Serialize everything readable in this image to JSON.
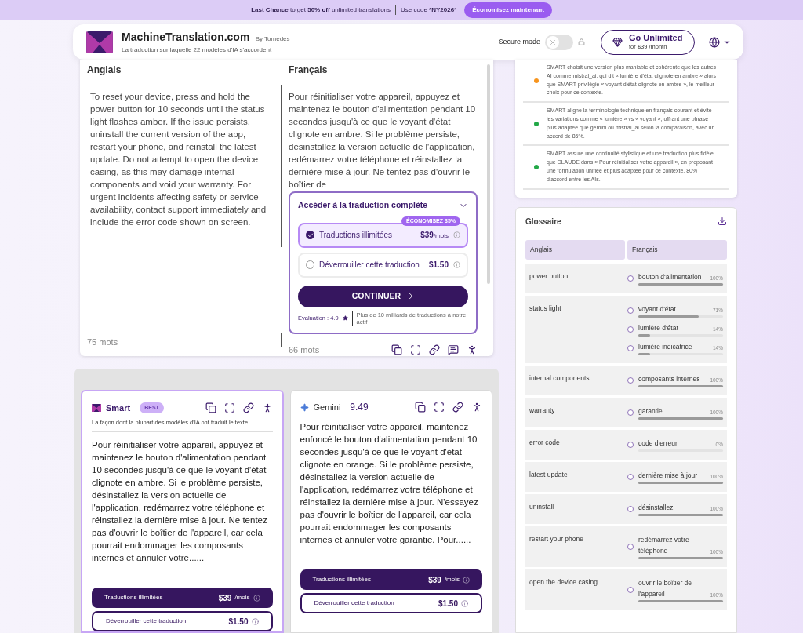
{
  "banner": {
    "message": "**Last Chance** to get **50% off** unlimited translations",
    "code_text": "Use code ***NY2026***",
    "button": "Économisez maintenant"
  },
  "header": {
    "brand": "MachineTranslation.com",
    "by": "| By Tomedes",
    "tagline": "La traduction sur laquelle 22 modèles d'IA s'accordent",
    "secure_mode": {
      "label": "Secure mode",
      "on": false
    },
    "upgrade": {
      "title": "Go Unlimited",
      "subtitle": "for $39 /month"
    }
  },
  "editor": {
    "source": {
      "language": "Anglais",
      "text": "To reset your device, press and hold the power button for 10 seconds until the status light flashes amber. If the issue persists, uninstall the current version of the app, restart your phone, and reinstall the latest update. Do not attempt to open the device casing, as this may damage internal components and void your warranty. For urgent incidents affecting safety or service availability, contact support immediately and include the error code shown on screen.",
      "word_count": "75 mots"
    },
    "target": {
      "language": "Français",
      "text": "Pour réinitialiser votre appareil, appuyez et maintenez le bouton d'alimentation pendant 10 secondes jusqu'à ce que le voyant d'état clignote en ambre. Si le problème persiste, désinstallez la version actuelle de l'application, redémarrez votre téléphone et réinstallez la dernière mise à jour. Ne tentez pas d'ouvrir le boîtier de",
      "word_count": "66 mots"
    },
    "paywall": {
      "title": "Accéder à la traduction complète",
      "plans": [
        {
          "label": "Traductions illimitées",
          "price": "$39",
          "unit": "/mois",
          "badge": "ÉCONOMISEZ 35%",
          "selected": true
        },
        {
          "label": "Déverrouiller cette traduction",
          "price": "$1.50",
          "selected": false
        }
      ],
      "button": "CONTINUER",
      "rating": "Évaluation : 4.9",
      "note": "Plus de 10 milliards de traductions à notre actif"
    }
  },
  "insights": [
    {
      "text": "SMART choisit une version plus maniable et cohérente que les autres AI comme mistral_ai, qui dit « lumière d'état clignote en ambre » alors que SMART privilégie « voyant d'état clignote en ambre », le meilleur choix pour ce contexte.",
      "color": "#f7941d"
    },
    {
      "text": "SMART aligne la terminologie technique en français courant et évite les variations comme « lumière » vs « voyant », offrant une phrase plus adaptée que gemini ou mistral_ai selon la comparaison, avec un accord de 85%.",
      "color": "#22a847"
    },
    {
      "text": "SMART assure une continuité stylistique et une traduction plus fidèle que CLAUDE dans « Pour réinitialiser votre appareil », en proposant une formulation unifiée et plus adaptée pour ce contexte, 80% d'accord entre les AIs.",
      "color": "#22a847"
    }
  ],
  "glossary": {
    "title": "Glossaire",
    "columns": [
      "Anglais",
      "Français"
    ],
    "rows": [
      {
        "term": "power button",
        "translations": [
          {
            "term": "bouton d'alimentation",
            "percent": "100%",
            "level": 1
          }
        ]
      },
      {
        "term": "status light",
        "translations": [
          {
            "term": "voyant d'état",
            "percent": "71%",
            "level": 0.71
          },
          {
            "term": "lumière d'état",
            "percent": "14%",
            "level": 0.14
          },
          {
            "term": "lumière indicatrice",
            "percent": "14%",
            "level": 0.14
          }
        ]
      },
      {
        "term": "internal components",
        "translations": [
          {
            "term": "composants internes",
            "percent": "100%",
            "level": 1
          }
        ]
      },
      {
        "term": "warranty",
        "translations": [
          {
            "term": "garantie",
            "percent": "100%",
            "level": 1
          }
        ]
      },
      {
        "term": "error code",
        "translations": [
          {
            "term": "code d'erreur",
            "percent": "0%",
            "level": 0
          }
        ]
      },
      {
        "term": "latest update",
        "translations": [
          {
            "term": "dernière mise à jour",
            "percent": "100%",
            "level": 1
          }
        ]
      },
      {
        "term": "uninstall",
        "translations": [
          {
            "term": "désinstallez",
            "percent": "100%",
            "level": 1
          }
        ]
      },
      {
        "term": "restart your phone",
        "translations": [
          {
            "term": "redémarrez votre téléphone",
            "percent": "100%",
            "level": 1
          }
        ]
      },
      {
        "term": "open the device casing",
        "translations": [
          {
            "term": "ouvrir le boîtier de l'appareil",
            "percent": "100%",
            "level": 1
          }
        ]
      }
    ]
  },
  "models": [
    {
      "kind": "smart",
      "name": "Smart",
      "badge": "BEST",
      "selected": true,
      "subtitle": "La façon dont la plupart des modèles d'IA ont traduit le texte",
      "text": "Pour réinitialiser votre appareil, appuyez et maintenez le bouton d'alimentation pendant 10 secondes jusqu'à ce que le voyant d'état clignote en ambre. Si le problème persiste, désinstallez la version actuelle de l'application, redémarrez votre téléphone et réinstallez la dernière mise à jour. Ne tentez pas d'ouvrir le boîtier de l'appareil, car cela pourrait endommager les composants internes et annuler votre......",
      "plans": [
        {
          "kind": "primary",
          "label": "Traductions illimitées",
          "price": "$39",
          "unit": "/mois"
        },
        {
          "kind": "outline",
          "label": "Déverrouiller cette traduction",
          "price": "$1.50"
        }
      ]
    },
    {
      "kind": "gemini",
      "name": "Gemini",
      "score": "9.49",
      "selected": false,
      "text": "Pour réinitialiser votre appareil, maintenez enfoncé le bouton d'alimentation pendant 10 secondes jusqu'à ce que le voyant d'état clignote en orange. Si le problème persiste, désinstallez la version actuelle de l'application, redémarrez votre téléphone et réinstallez la dernière mise à jour. N'essayez pas d'ouvrir le boîtier de l'appareil, car cela pourrait endommager les composants internes et annuler votre garantie. Pour......",
      "plans": [
        {
          "kind": "primary",
          "label": "Traductions illimitées",
          "price": "$39",
          "unit": "/mois"
        },
        {
          "kind": "outline",
          "label": "Déverrouiller cette traduction",
          "price": "$1.50"
        }
      ]
    }
  ]
}
